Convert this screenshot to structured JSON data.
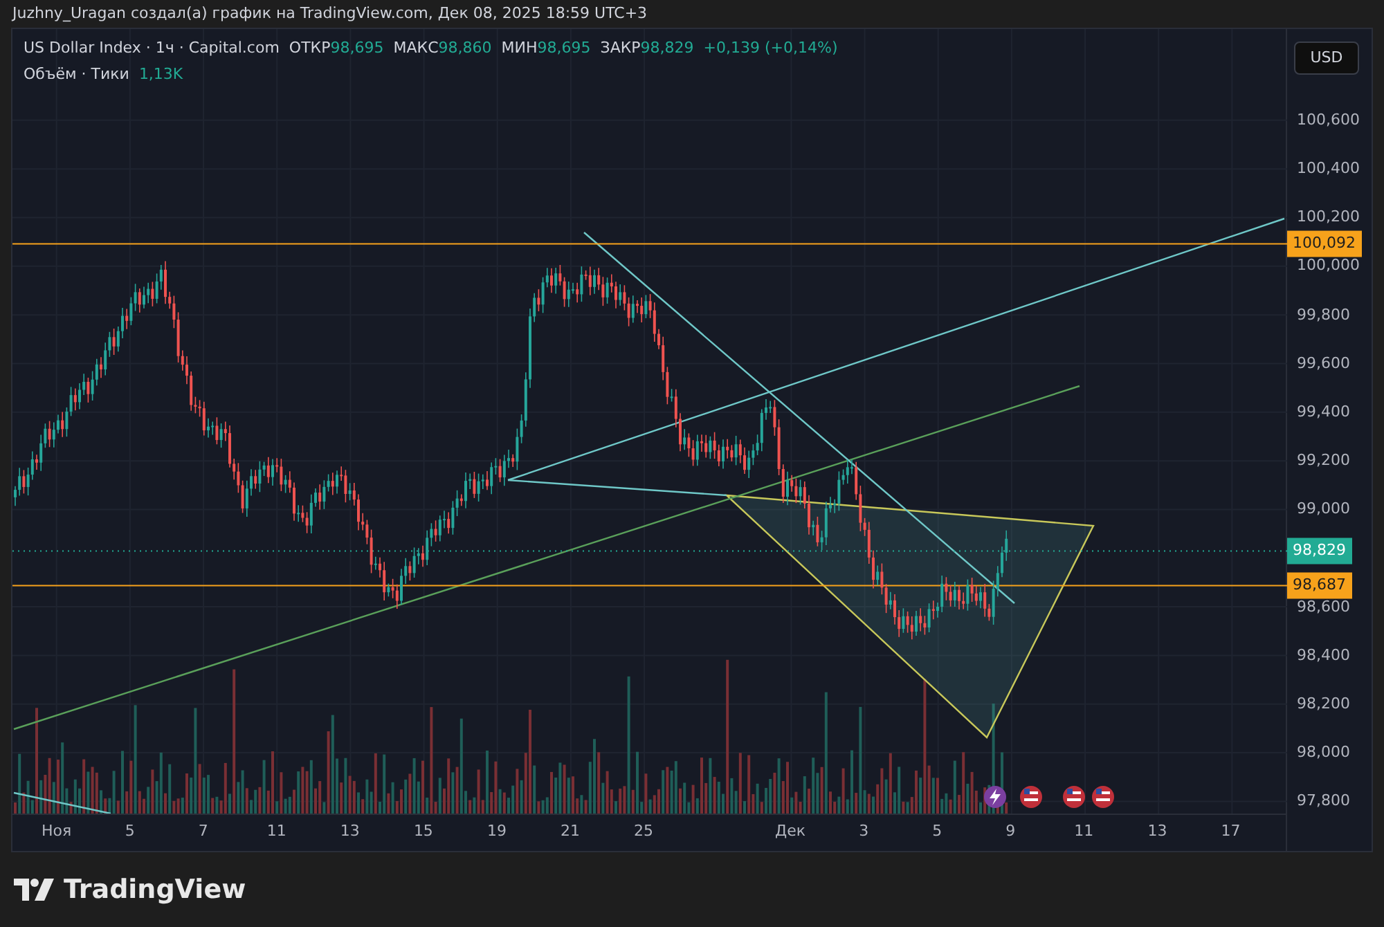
{
  "header": {
    "title": "Juzhny_Uragan создал(а) график на TradingView.com, Дек 08, 2025 18:59 UTC+3"
  },
  "legend": {
    "symbol": "US Dollar Index · 1ч · Capital.com",
    "stats": [
      {
        "label": "ОТКР",
        "value": "98,695"
      },
      {
        "label": "МАКС",
        "value": "98,860"
      },
      {
        "label": "МИН",
        "value": "98,695"
      },
      {
        "label": "ЗАКР",
        "value": "98,829"
      }
    ],
    "change": "+0,139 (+0,14%)"
  },
  "volume": {
    "label": "Объём · Тики",
    "value": "1,13K"
  },
  "currency_button": "USD",
  "chart": {
    "price_axis": [
      "100,600",
      "100,400",
      "100,200",
      "100,000",
      "99,800",
      "99,600",
      "99,400",
      "99,200",
      "99,000",
      "98,600",
      "98,400",
      "98,200",
      "98,000",
      "97,800"
    ],
    "price_tags": [
      {
        "kind": "line",
        "label": "100,092",
        "color": "#f7a21b"
      },
      {
        "kind": "last",
        "label": "98,829",
        "color": "#22ab94"
      },
      {
        "kind": "line",
        "label": "98,687",
        "color": "#f7a21b"
      }
    ],
    "time_axis": [
      "Ноя",
      "5",
      "7",
      "11",
      "13",
      "15",
      "19",
      "21",
      "25",
      "Дек",
      "3",
      "5",
      "9",
      "11",
      "13",
      "17"
    ]
  },
  "footer": {
    "brand": "TradingView"
  }
}
